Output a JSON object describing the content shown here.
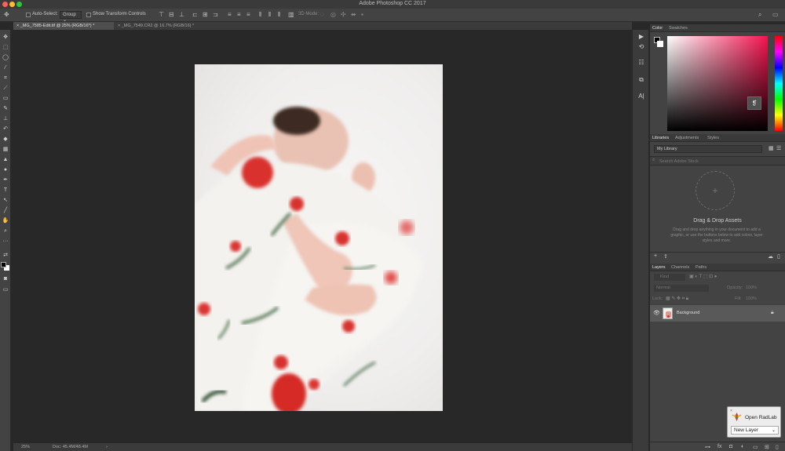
{
  "window": {
    "title": "Adobe Photoshop CC 2017"
  },
  "traffic_lights": [
    "#ff5f57",
    "#febc2e",
    "#28c840"
  ],
  "options_bar": {
    "auto_select_label": "Auto-Select:",
    "auto_select_value": "Group",
    "show_transform_label": "Show Transform Controls",
    "mode_label": "3D Mode:"
  },
  "document_tabs": [
    {
      "label": "_MG_7585-Edit.tif @ 25% (RGB/16*) *",
      "active": true
    },
    {
      "label": "_MG_7549.CR2 @ 16.7% (RGB/16) *",
      "active": false
    }
  ],
  "status_bar": {
    "zoom": "25%",
    "doc_size": "Doc: 45.4M/48.4M"
  },
  "color_panel": {
    "tabs": [
      "Color",
      "Swatches"
    ],
    "foreground": "#000000",
    "background": "#ffffff",
    "hue_color": "#f4144f"
  },
  "libraries_panel": {
    "tabs": [
      "Libraries",
      "Adjustments",
      "Styles"
    ],
    "library_name": "My Library",
    "search_placeholder": "Search Adobe Stock",
    "drag_title": "Drag & Drop Assets",
    "drag_description": "Drag and drop anything in your document to add a graphic, or use the buttons below to add colors, layer styles and more."
  },
  "layers_panel": {
    "tabs": [
      "Layers",
      "Channels",
      "Paths"
    ],
    "filter_kind": "Kind",
    "blend_mode": "Normal",
    "opacity_label": "Opacity:",
    "opacity_value": "100%",
    "lock_label": "Lock:",
    "fill_label": "Fill:",
    "fill_value": "100%",
    "layers": [
      {
        "name": "Background",
        "visible": true,
        "locked": true
      }
    ]
  },
  "radlab": {
    "title": "Open RadLab",
    "select_value": "New Layer"
  }
}
